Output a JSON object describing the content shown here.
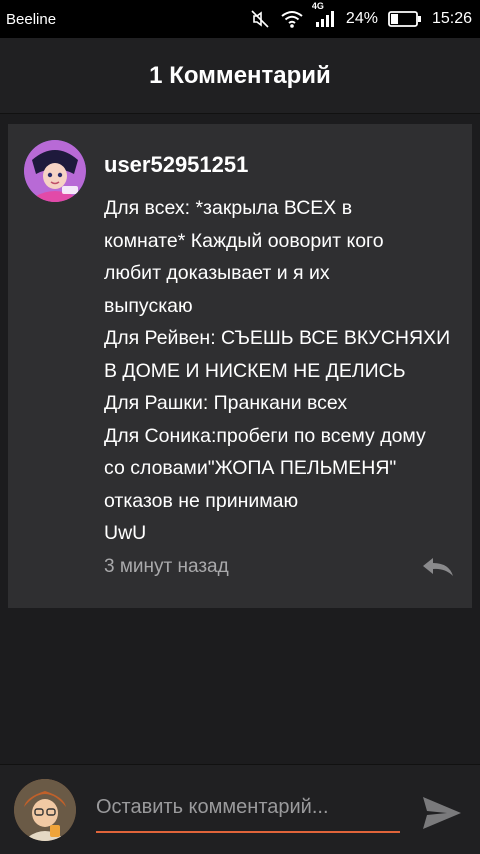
{
  "status_bar": {
    "carrier": "Beeline",
    "network": "4G",
    "battery": "24%",
    "time": "15:26"
  },
  "header": {
    "title": "1 Комментарий"
  },
  "comment": {
    "username": "user52951251",
    "lines": [
      "Для всех: *закрыла ВСЕХ в",
      "комнате* Каждый ооворит кого",
      "любит доказывает и я их",
      "выпускаю",
      "Для Рейвен: СЪЕШЬ ВСЕ ВКУСНЯХИ",
      "В ДОМЕ И НИСКЕМ НЕ ДЕЛИСЬ",
      "Для Рашки: Пранкани всех",
      "Для Соника:пробеги по всему дому",
      "со словами\"ЖОПА ПЕЛЬМЕНЯ\"",
      "отказов не принимаю",
      "UwU"
    ],
    "timestamp": "3 минут назад"
  },
  "composer": {
    "placeholder": "Оставить комментарий..."
  },
  "colors": {
    "background": "#1c1c1e",
    "card": "#2f2f31",
    "accent": "#e0643a",
    "muted_text": "#a9a9ab"
  },
  "icons": {
    "mute": "mute-icon",
    "wifi": "wifi-icon",
    "signal": "signal-icon",
    "battery": "battery-icon",
    "reply": "reply-icon",
    "send": "send-icon"
  }
}
